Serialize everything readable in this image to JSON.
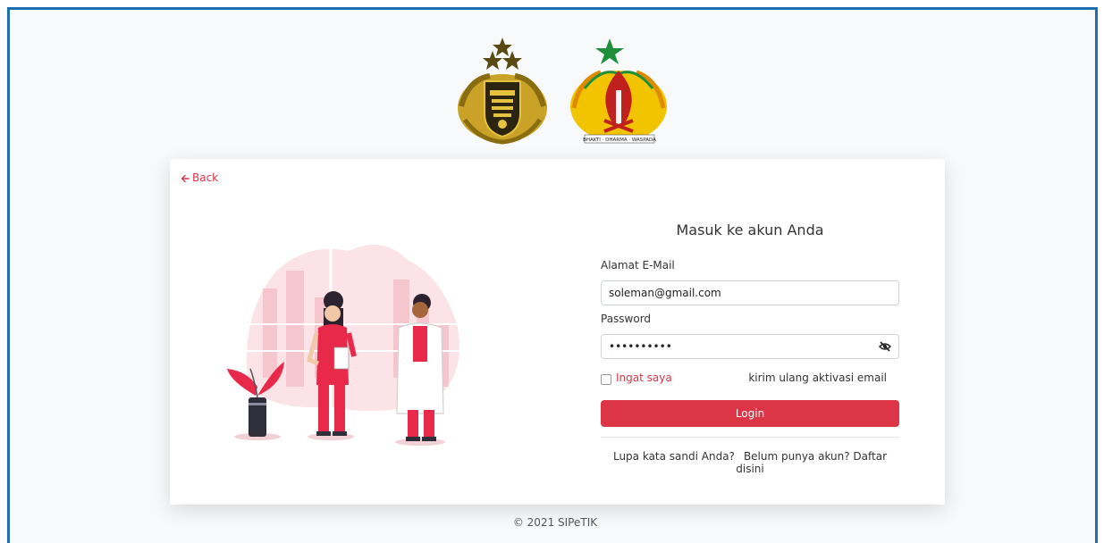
{
  "back": {
    "label": "Back"
  },
  "form": {
    "title": "Masuk ke akun Anda",
    "email_label": "Alamat E-Mail",
    "email_value": "soleman@gmail.com",
    "password_label": "Password",
    "password_value": "••••••••••",
    "remember_label": "Ingat saya",
    "resend_label": "kirim ulang aktivasi email",
    "login_label": "Login",
    "forgot_label": "Lupa kata sandi Anda?",
    "register_label": "Belum punya akun? Daftar disini"
  },
  "logos": {
    "right_motto": "BHAKTI · DHARMA · WASPADA"
  },
  "footer": {
    "text": "© 2021 SIPeTIK"
  },
  "colors": {
    "accent": "#dc3545",
    "frame_border": "#1f6db3",
    "page_bg": "#f8f9fb"
  },
  "icons": {
    "back": "arrow-left-icon",
    "password_toggle": "eye-slash-icon"
  }
}
